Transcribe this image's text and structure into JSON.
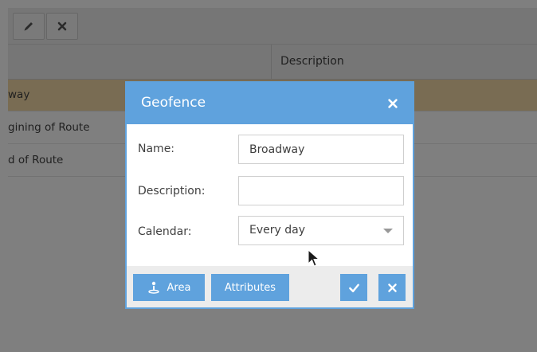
{
  "toolbar": {
    "edit_icon": "pencil-icon",
    "delete_icon": "close-icon"
  },
  "grid": {
    "columns": [
      "Description"
    ],
    "rows": [
      {
        "name": "way",
        "selected": true
      },
      {
        "name": "gining of Route",
        "selected": false
      },
      {
        "name": "d of Route",
        "selected": false
      }
    ]
  },
  "dialog": {
    "title": "Geofence",
    "fields": {
      "name_label": "Name:",
      "name_value": "Broadway",
      "description_label": "Description:",
      "description_value": "",
      "calendar_label": "Calendar:",
      "calendar_value": "Every day"
    },
    "buttons": {
      "area_label": "Area",
      "attributes_label": "Attributes"
    }
  },
  "colors": {
    "accent": "#5fa2dd",
    "selected_row": "#f3d9a6"
  }
}
